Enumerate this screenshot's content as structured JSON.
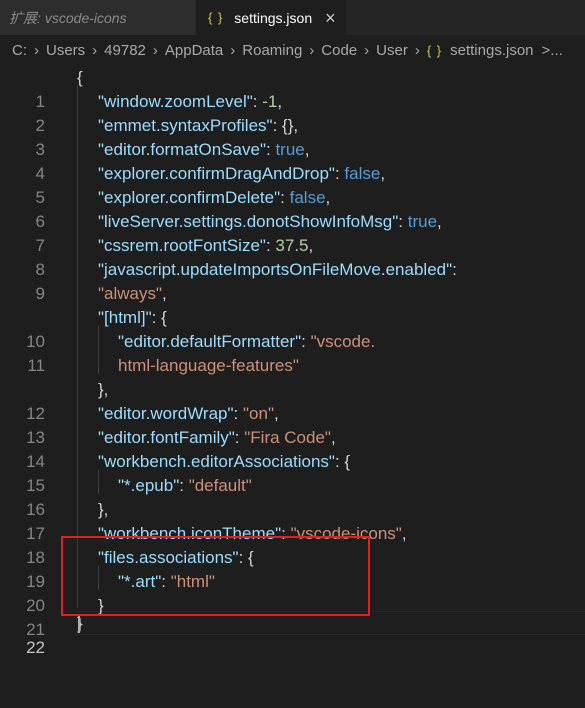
{
  "tabs": {
    "inactive": {
      "label_prefix": "扩展:",
      "label_name": "vscode-icons"
    },
    "active": {
      "icon": "{ }",
      "label": "settings.json",
      "close_icon": "×"
    }
  },
  "breadcrumb": {
    "segments": [
      "C:",
      "Users",
      "49782",
      "AppData",
      "Roaming",
      "Code",
      "User"
    ],
    "file_icon": "{ }",
    "file": "settings.json",
    "overflow": ">..."
  },
  "line_numbers": [
    "1",
    "2",
    "3",
    "4",
    "5",
    "6",
    "7",
    "8",
    "9",
    "",
    "10",
    "11",
    "",
    "12",
    "13",
    "14",
    "15",
    "16",
    "17",
    "18",
    "19",
    "20",
    "21",
    "22"
  ],
  "code": {
    "open_brace": "{",
    "l2": {
      "key": "\"window.zoomLevel\"",
      "value": "-1"
    },
    "l3": {
      "key": "\"emmet.syntaxProfiles\"",
      "value": "{}"
    },
    "l4": {
      "key": "\"editor.formatOnSave\"",
      "value": "true"
    },
    "l5": {
      "key": "\"explorer.confirmDragAndDrop\"",
      "value": "false"
    },
    "l6": {
      "key": "\"explorer.confirmDelete\"",
      "value": "false"
    },
    "l7": {
      "key": "\"liveServer.settings.donotShowInfoMsg\"",
      "value": "true"
    },
    "l8": {
      "key": "\"cssrem.rootFontSize\"",
      "value": "37.5"
    },
    "l9": {
      "key": "\"javascript.updateImportsOnFileMove.enabled\"",
      "value": "\"always\""
    },
    "l10": {
      "key": "\"[html]\"",
      "value": "{"
    },
    "l11": {
      "key": "\"editor.defaultFormatter\"",
      "value_part1": "\"vscode.",
      "value_part2": "html-language-features\""
    },
    "l12": {
      "text": "},"
    },
    "l13": {
      "key": "\"editor.wordWrap\"",
      "value": "\"on\""
    },
    "l14": {
      "key": "\"editor.fontFamily\"",
      "value": "\"Fira Code\""
    },
    "l15": {
      "key": "\"workbench.editorAssociations\"",
      "value": "{"
    },
    "l16": {
      "key": "\"*.epub\"",
      "value": "\"default\""
    },
    "l17": {
      "text": "},"
    },
    "l18": {
      "key": "\"workbench.iconTheme\"",
      "value": "\"vscode-icons\""
    },
    "l19": {
      "key": "\"files.associations\"",
      "value": "{"
    },
    "l20": {
      "key": "\"*.art\"",
      "value": "\"html\""
    },
    "l21": {
      "text": "}"
    },
    "l22": {
      "text": "}"
    }
  },
  "colors": {
    "key": "#9cdcfe",
    "string": "#ce9178",
    "number": "#b5cea8",
    "boolean": "#569cd6",
    "highlight_box": "#e51e1e"
  }
}
